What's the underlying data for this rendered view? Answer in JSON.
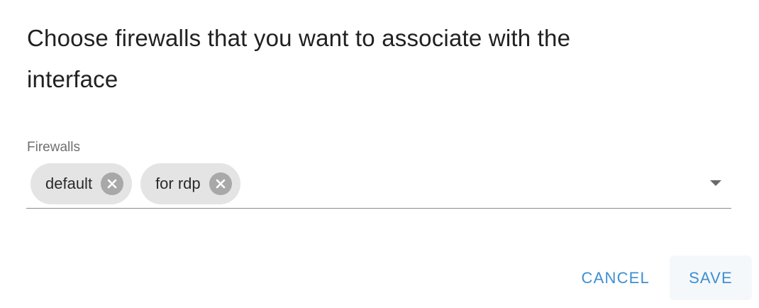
{
  "dialog": {
    "title": "Choose firewalls that you want to associate with the interface"
  },
  "firewalls_field": {
    "label": "Firewalls",
    "chips": [
      {
        "label": "default",
        "remove_icon": "close-circle-icon"
      },
      {
        "label": "for rdp",
        "remove_icon": "close-circle-icon"
      }
    ],
    "dropdown_icon": "caret-down-icon"
  },
  "actions": {
    "cancel_label": "CANCEL",
    "save_label": "SAVE"
  },
  "colors": {
    "accent": "#3d8fd1",
    "chip_background": "#e4e4e4",
    "chip_remove": "#a8a8a8",
    "title_text": "#212121"
  }
}
